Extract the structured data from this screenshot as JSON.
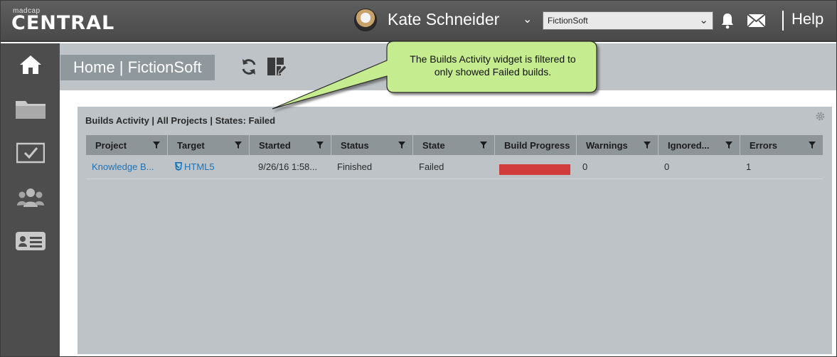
{
  "app": {
    "brand_small": "madcap",
    "brand_big": "CENTRAL"
  },
  "header": {
    "user_name": "Kate Schneider",
    "license": "FictionSoft",
    "help_label": "Help"
  },
  "sidebar": {
    "items": [
      {
        "icon": "home-icon"
      },
      {
        "icon": "folder-icon"
      },
      {
        "icon": "tasks-icon"
      },
      {
        "icon": "users-icon"
      },
      {
        "icon": "id-card-icon"
      }
    ]
  },
  "page": {
    "breadcrumb": "Home | FictionSoft"
  },
  "widget": {
    "title": "Builds Activity | All Projects | States: Failed",
    "columns": [
      "Project",
      "Target",
      "Started",
      "Status",
      "State",
      "Build Progress",
      "Warnings",
      "Ignored...",
      "Errors"
    ],
    "rows": [
      {
        "project": "Knowledge B...",
        "target": "HTML5",
        "started": "9/26/16 1:58...",
        "status": "Finished",
        "state": "Failed",
        "build_progress": 1.0,
        "warnings": "0",
        "ignored": "0",
        "errors": "1"
      }
    ],
    "progress_color": "#d23c3c"
  },
  "callout": {
    "line1": "The Builds Activity widget is filtered to",
    "line2": "only showed Failed builds."
  },
  "colors": {
    "topbar": "#4a4a4a",
    "sidebar": "#4d4d4d",
    "panel": "#bdc3c7",
    "link": "#1f73b7",
    "callout_fill": "#c5ec8e"
  }
}
